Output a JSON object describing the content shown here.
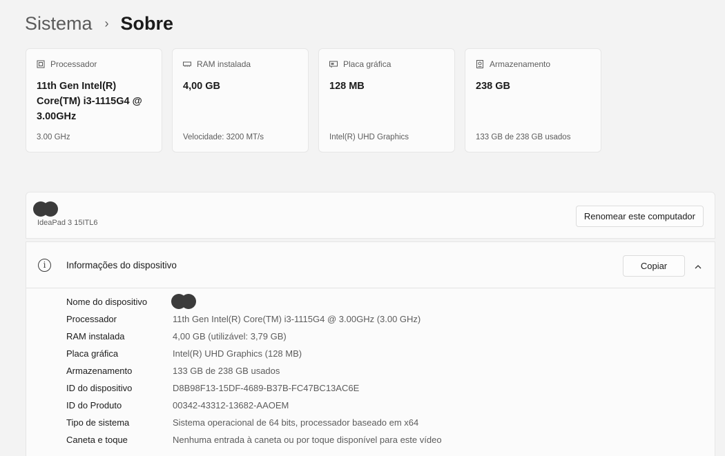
{
  "breadcrumb": {
    "parent": "Sistema",
    "separator": "›",
    "current": "Sobre"
  },
  "specs": [
    {
      "icon": "processor-icon",
      "label": "Processador",
      "value": "11th Gen Intel(R) Core(TM) i3-1115G4 @ 3.00GHz",
      "sub": "3.00 GHz"
    },
    {
      "icon": "ram-icon",
      "label": "RAM instalada",
      "value": "4,00 GB",
      "sub": "Velocidade: 3200 MT/s"
    },
    {
      "icon": "graphics-card-icon",
      "label": "Placa gráfica",
      "value": "128 MB",
      "sub": "Intel(R) UHD Graphics"
    },
    {
      "icon": "storage-icon",
      "label": "Armazenamento",
      "value": "238 GB",
      "sub": "133 GB de 238 GB usados"
    }
  ],
  "device": {
    "model": "IdeaPad 3 15ITL6",
    "rename_label": "Renomear este computador"
  },
  "info": {
    "title": "Informações do dispositivo",
    "copy_label": "Copiar",
    "rows": [
      {
        "label": "Nome do dispositivo",
        "value": ""
      },
      {
        "label": "Processador",
        "value": "11th Gen Intel(R) Core(TM) i3-1115G4 @ 3.00GHz (3.00 GHz)"
      },
      {
        "label": "RAM instalada",
        "value": "4,00 GB (utilizável: 3,79 GB)"
      },
      {
        "label": "Placa gráfica",
        "value": "Intel(R) UHD Graphics (128 MB)"
      },
      {
        "label": "Armazenamento",
        "value": "133 GB de 238 GB usados"
      },
      {
        "label": "ID do dispositivo",
        "value": "D8B98F13-15DF-4689-B37B-FC47BC13AC6E"
      },
      {
        "label": "ID do Produto",
        "value": "00342-43312-13682-AAOEM"
      },
      {
        "label": "Tipo de sistema",
        "value": "Sistema operacional de 64 bits, processador baseado em x64"
      },
      {
        "label": "Caneta e toque",
        "value": "Nenhuma entrada à caneta ou por toque disponível para este vídeo"
      }
    ]
  }
}
